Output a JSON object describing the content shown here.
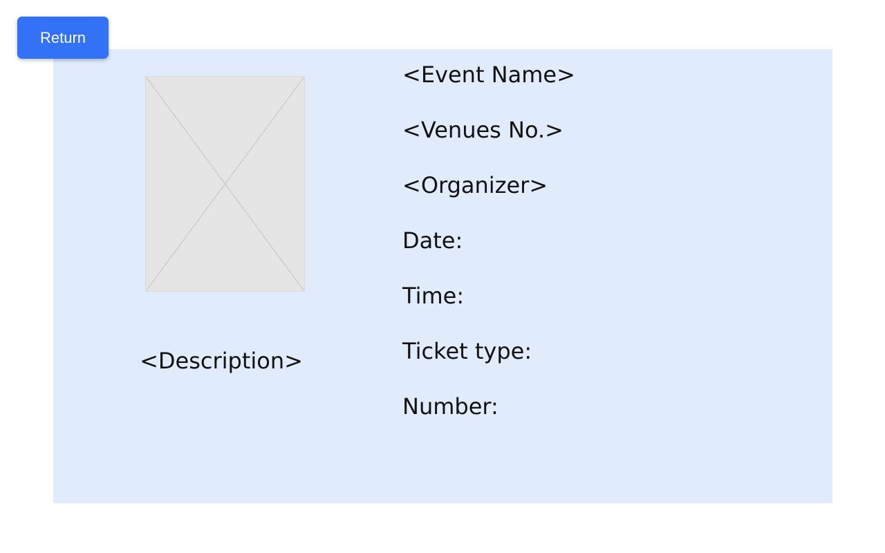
{
  "header": {
    "return_label": "Return"
  },
  "event": {
    "image_alt": "Event image placeholder",
    "description": "<Description>",
    "details": [
      "<Event Name>",
      "<Venues No.>",
      "<Organizer>",
      "Date:",
      "Time:",
      "Ticket type:",
      "Number:"
    ]
  },
  "colors": {
    "accent": "#3371f7",
    "panel_background": "#e0ebfc",
    "placeholder_fill": "#e5e5e5",
    "placeholder_stroke": "#c8c8c8",
    "text": "#111111"
  }
}
